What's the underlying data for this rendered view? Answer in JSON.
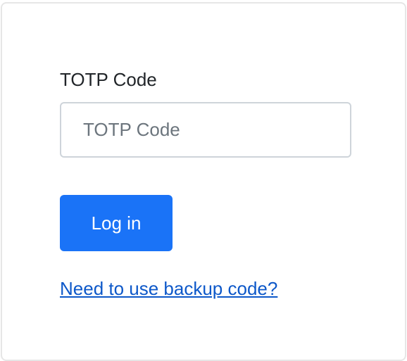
{
  "totp": {
    "label": "TOTP Code",
    "placeholder": "TOTP Code",
    "value": ""
  },
  "actions": {
    "login_label": "Log in",
    "backup_link": "Need to use backup code?"
  },
  "colors": {
    "primary": "#1a73f7",
    "link": "#0d58c9"
  }
}
